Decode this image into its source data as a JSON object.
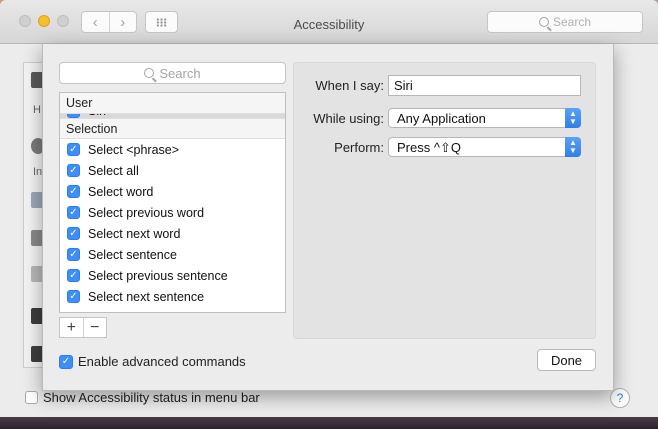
{
  "window": {
    "title": "Accessibility",
    "search_placeholder": "Search",
    "status_label": "Show Accessibility status in menu bar",
    "help_label": "?"
  },
  "background_sidebar": {
    "peek_text_1": "H",
    "peek_text_2": "In"
  },
  "sheet": {
    "list_search_placeholder": "Search",
    "sections": [
      {
        "header": "User",
        "items": [
          {
            "label": "Siri",
            "checked": true,
            "selected": true
          }
        ]
      },
      {
        "header": "Selection",
        "items": [
          {
            "label": "Select <phrase>",
            "checked": true
          },
          {
            "label": "Select all",
            "checked": true
          },
          {
            "label": "Select word",
            "checked": true
          },
          {
            "label": "Select previous word",
            "checked": true
          },
          {
            "label": "Select next word",
            "checked": true
          },
          {
            "label": "Select sentence",
            "checked": true
          },
          {
            "label": "Select previous sentence",
            "checked": true
          },
          {
            "label": "Select next sentence",
            "checked": true
          }
        ]
      }
    ],
    "add_label": "+",
    "remove_label": "−",
    "advanced_label": "Enable advanced commands",
    "advanced_checked": true,
    "when_i_say_label": "When I say:",
    "when_i_say_value": "Siri",
    "while_using_label": "While using:",
    "while_using_value": "Any Application",
    "perform_label": "Perform:",
    "perform_value": "Press ^⇧Q",
    "done_label": "Done"
  },
  "colors": {
    "accent": "#3d8ef7",
    "selection": "#d9d9d9"
  },
  "icons": {
    "checkmark": "✓",
    "search": "search-icon",
    "back": "‹",
    "forward": "›"
  }
}
